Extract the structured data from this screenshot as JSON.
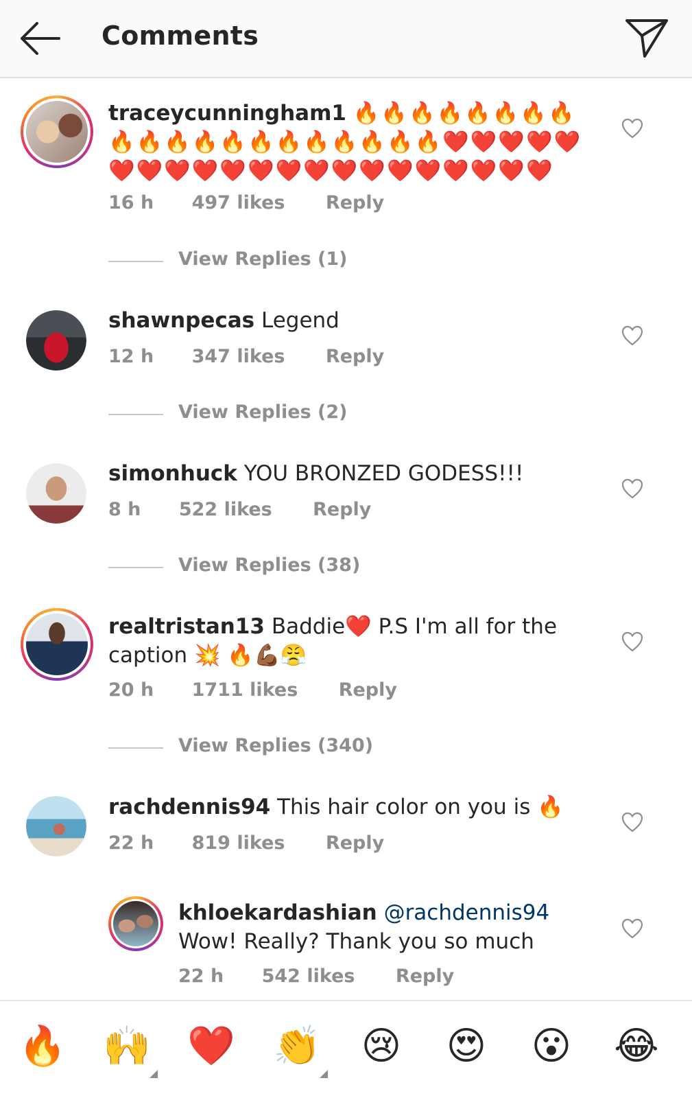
{
  "header": {
    "title": "Comments"
  },
  "comments": [
    {
      "username": "traceycunningham1",
      "text": "🔥🔥🔥🔥🔥🔥🔥🔥🔥🔥🔥🔥🔥🔥🔥🔥🔥🔥🔥🔥❤️❤️❤️❤️❤️❤️❤️❤️❤️❤️❤️❤️❤️❤️❤️❤️❤️❤️❤️❤️❤️",
      "time": "16 h",
      "likes": "497 likes",
      "reply": "Reply",
      "view_replies": "View Replies (1)"
    },
    {
      "username": "shawnpecas",
      "text": "Legend",
      "time": "12 h",
      "likes": "347 likes",
      "reply": "Reply",
      "view_replies": "View Replies (2)"
    },
    {
      "username": "simonhuck",
      "text": "YOU BRONZED GODESS!!!",
      "time": "8 h",
      "likes": "522 likes",
      "reply": "Reply",
      "view_replies": "View Replies (38)"
    },
    {
      "username": "realtristan13",
      "text": "Baddie❤️ P.S I'm all for the caption 💥 🔥💪🏾😤",
      "time": "20 h",
      "likes": "1711 likes",
      "reply": "Reply",
      "view_replies": "View Replies (340)"
    },
    {
      "username": "rachdennis94",
      "text": "This hair color on you is 🔥",
      "time": "22 h",
      "likes": "819 likes",
      "reply": "Reply"
    }
  ],
  "reply": {
    "username": "khloekardashian",
    "mention": "@rachdennis94",
    "text": "Wow! Really? Thank you so much",
    "time": "22 h",
    "likes": "542 likes",
    "reply": "Reply"
  },
  "emoji_bar": [
    "🔥",
    "🙌",
    "❤️",
    "👏",
    "😢",
    "😍",
    "😮",
    "😂"
  ],
  "colors": {
    "meta_gray": "#8e8e8e",
    "mention_blue": "#003569",
    "text": "#262626"
  }
}
